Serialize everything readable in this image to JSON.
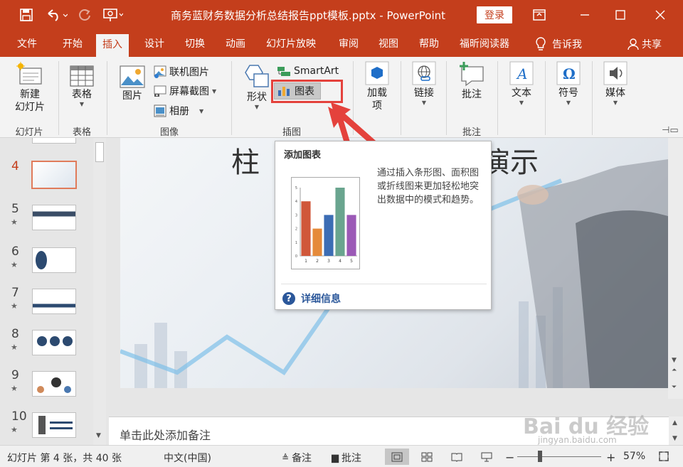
{
  "titlebar": {
    "title": "商务蓝财务数据分析总结报告ppt模板.pptx  -  PowerPoint",
    "login": "登录"
  },
  "tabs": [
    "文件",
    "开始",
    "插入",
    "设计",
    "切换",
    "动画",
    "幻灯片放映",
    "审阅",
    "视图",
    "帮助",
    "福昕阅读器"
  ],
  "tell_me": "告诉我",
  "share": "共享",
  "ribbon": {
    "new_slide": "新建\n幻灯片",
    "group_slides": "幻灯片",
    "table": "表格",
    "group_tables": "表格",
    "picture": "图片",
    "online_picture": "联机图片",
    "screenshot": "屏幕截图",
    "album": "相册",
    "group_images": "图像",
    "shapes": "形状",
    "smartart": "SmartArt",
    "chart": "图表",
    "group_illustrations": "插图",
    "addins": "加载\n项",
    "link": "链接",
    "comment": "批注",
    "group_comments": "批注",
    "text": "文本",
    "symbol": "符号",
    "media": "媒体"
  },
  "slides": [
    {
      "num": "4",
      "star": false,
      "active": true
    },
    {
      "num": "5",
      "star": true
    },
    {
      "num": "6",
      "star": true
    },
    {
      "num": "7",
      "star": true
    },
    {
      "num": "8",
      "star": true
    },
    {
      "num": "9",
      "star": true
    },
    {
      "num": "10",
      "star": true
    }
  ],
  "slide": {
    "title_left": "柱",
    "title_right": "演示"
  },
  "tooltip": {
    "title": "添加图表",
    "description": "通过插入条形图、面积图或折线图来更加轻松地突出数据中的模式和趋势。",
    "more_info": "详细信息",
    "chart_categories": [
      "1",
      "2",
      "3",
      "4",
      "5"
    ],
    "chart_values": [
      4,
      2,
      3,
      5,
      3
    ],
    "chart_colors": [
      "#d0573a",
      "#e58a3a",
      "#3c6db4",
      "#6aa58f",
      "#9b59b6"
    ],
    "chart_ylim": [
      0,
      5
    ]
  },
  "notes": {
    "placeholder": "单击此处添加备注"
  },
  "statusbar": {
    "slide_info": "幻灯片 第 4 张，共 40 张",
    "language": "中文(中国)",
    "notes": "备注",
    "comments": "批注",
    "zoom": "57%"
  },
  "watermark": {
    "brand": "Bai du 经验",
    "url": "jingyan.baidu.com"
  },
  "colors": {
    "accent": "#c43e1c",
    "highlight_red": "#e4423c"
  }
}
